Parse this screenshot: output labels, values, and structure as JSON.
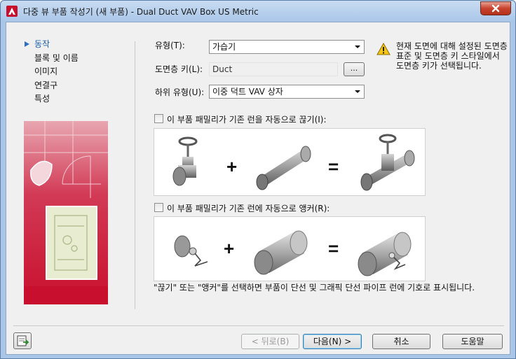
{
  "window": {
    "title": "다중 뷰 부품 작성기 (새 부품) - Dual Duct VAV Box US Metric"
  },
  "nav": {
    "items": [
      {
        "label": "동작",
        "active": true
      },
      {
        "label": "블록 및 이름",
        "active": false
      },
      {
        "label": "이미지",
        "active": false
      },
      {
        "label": "연결구",
        "active": false
      },
      {
        "label": "특성",
        "active": false
      }
    ]
  },
  "form": {
    "type_label": "유형(T):",
    "type_value": "가습기",
    "layer_key_label": "도면층 키(L):",
    "layer_key_value": "Duct",
    "browse_label": "...",
    "subtype_label": "하위 유형(U):",
    "subtype_value": "이중 덕트 VAV 상자"
  },
  "warning": {
    "icon": "warning-icon",
    "text": "현재 도면에 대해 설정된 도면층 표준 및 도면층 키 스타일에서 도면층 키가 선택됩니다."
  },
  "options": {
    "break_label": "이 부품 패밀리가 기존 런을 자동으로 끊기(I):",
    "break_checked": false,
    "anchor_label": "이 부품 패밀리가 기존 런에 자동으로 앵커(R):",
    "anchor_checked": false
  },
  "symbols": {
    "plus": "+",
    "equals": "="
  },
  "note": "\"끊기\" 또는 \"앵커\"를 선택하면 부품이 단선 및 그래픽 단선 파이프 런에 기호로 표시됩니다.",
  "buttons": {
    "back": "< 뒤로(B)",
    "next": "다음(N) >",
    "cancel": "취소",
    "help": "도움말"
  },
  "colors": {
    "accent": "#2a6fc0",
    "close": "#c7432d",
    "illustration": "#c8102e"
  }
}
